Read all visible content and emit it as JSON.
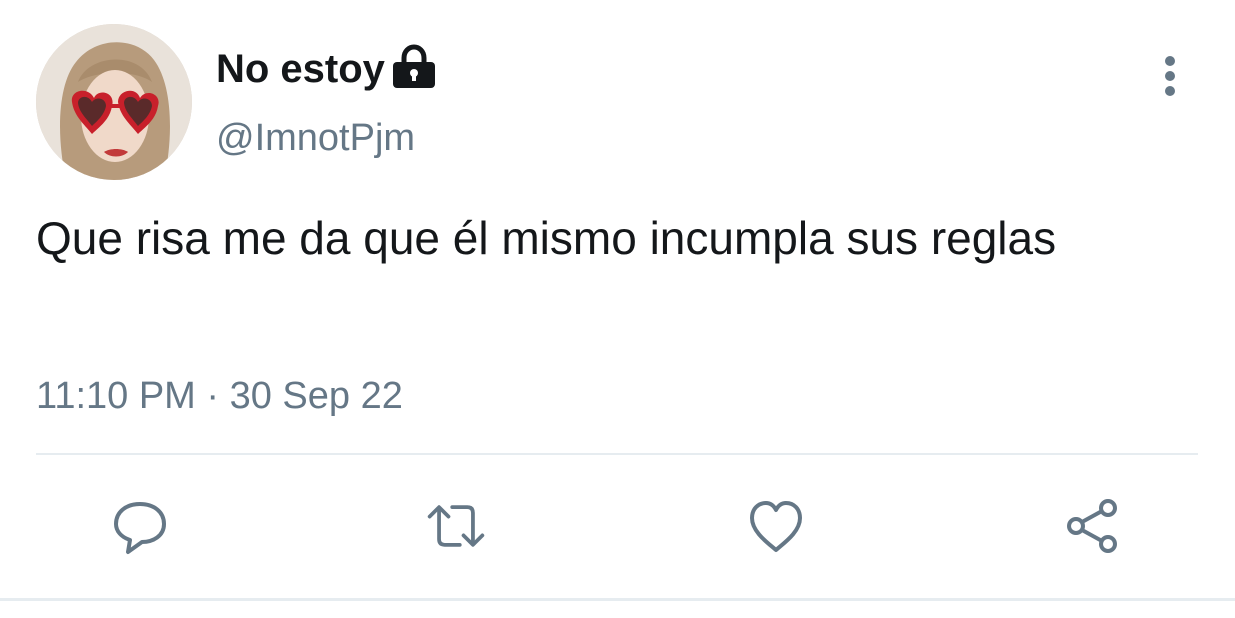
{
  "tweet": {
    "display_name": "No estoy",
    "handle": "@ImnotPjm",
    "text": "Que risa me da que él mismo incumpla sus reglas",
    "timestamp": "11:10 PM · 30 Sep 22"
  },
  "icons": {
    "lock": "lock-icon",
    "more": "more-vertical-icon",
    "reply": "reply-icon",
    "retweet": "retweet-icon",
    "like": "heart-icon",
    "share": "share-icon"
  },
  "colors": {
    "text_primary": "#14171a",
    "text_secondary": "#657786",
    "divider": "#e6ecf0",
    "icon": "#657786"
  }
}
